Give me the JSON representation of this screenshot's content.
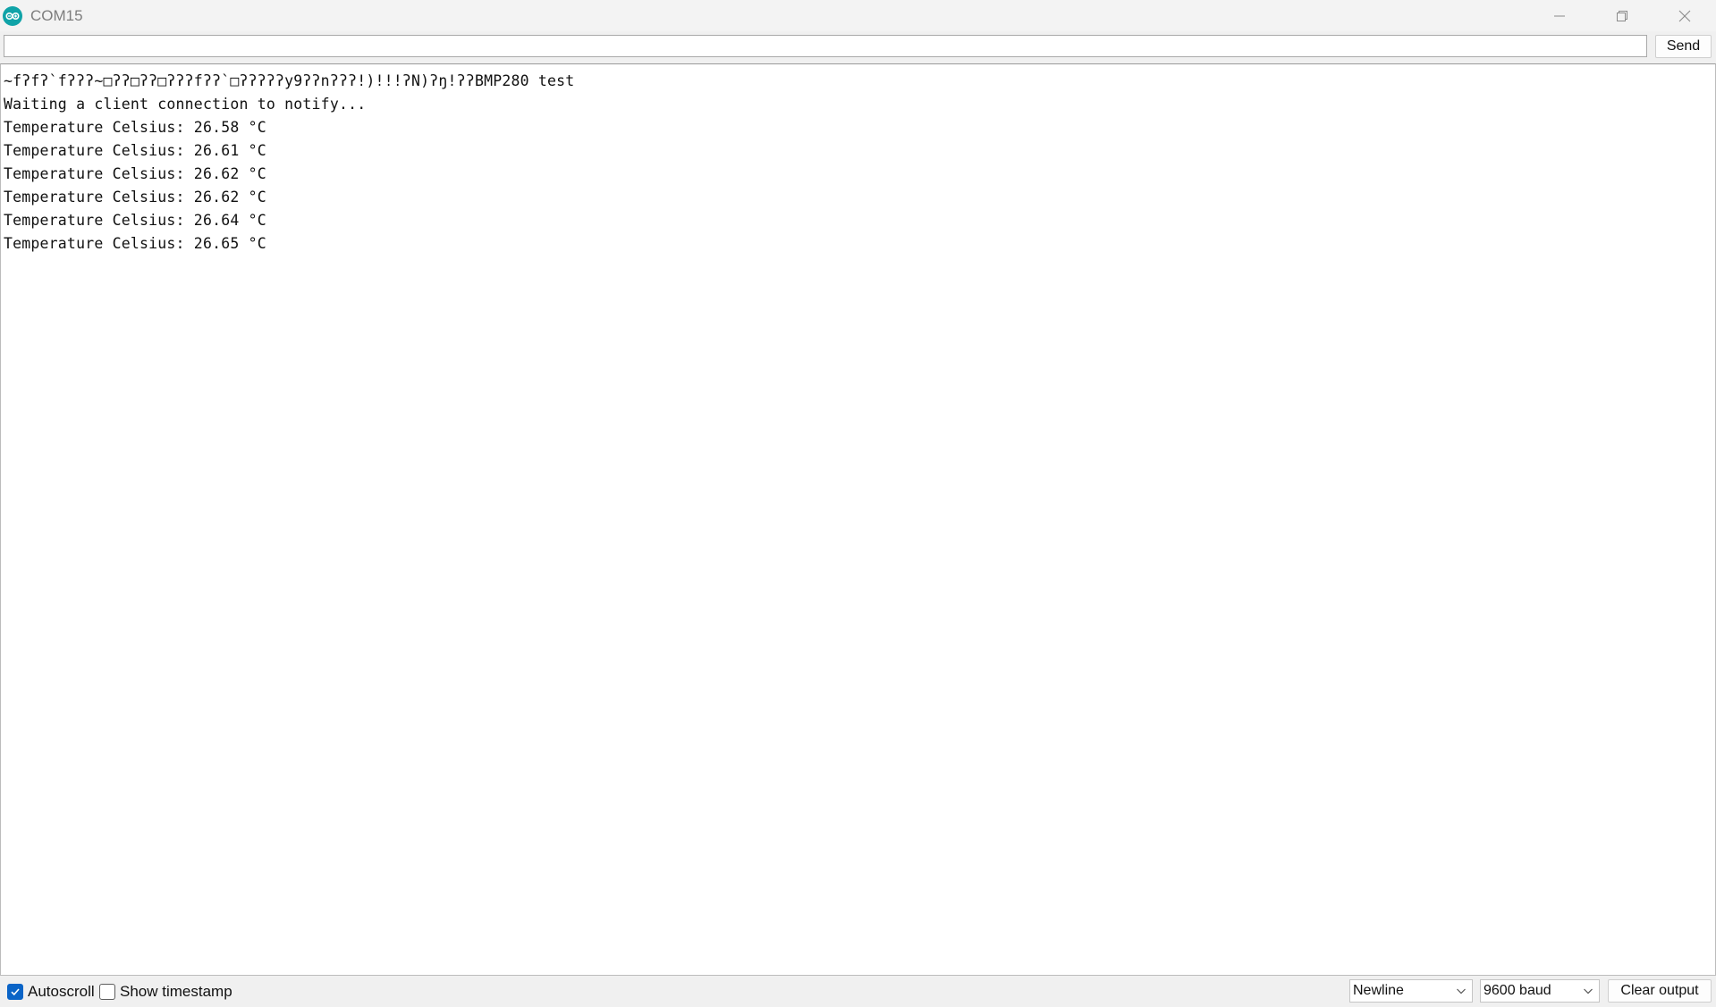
{
  "window": {
    "title": "COM15",
    "controls": [
      "minimize",
      "restore",
      "close"
    ]
  },
  "send_bar": {
    "input_value": "",
    "send_label": "Send"
  },
  "output": {
    "lines": [
      "~fʔfʔ`fʔʔʔ~□ʔʔ□ʔʔ□ʔʔʔfʔʔ`□ʔʔʔʔʔy9ʔʔnʔʔʔ!)!!!ʔN)ʔŋ!ʔʔBMP280 test",
      "Waiting a client connection to notify...",
      "Temperature Celsius: 26.58 °C",
      "Temperature Celsius: 26.61 °C",
      "Temperature Celsius: 26.62 °C",
      "Temperature Celsius: 26.62 °C",
      "Temperature Celsius: 26.64 °C",
      "Temperature Celsius: 26.65 °C"
    ]
  },
  "bottom_bar": {
    "autoscroll_label": "Autoscroll",
    "autoscroll_checked": true,
    "timestamp_label": "Show timestamp",
    "timestamp_checked": false,
    "line_ending_value": "Newline",
    "baud_value": "9600 baud",
    "clear_label": "Clear output"
  },
  "colors": {
    "accent": "#0a64c7",
    "app_icon": "#10a3a8"
  },
  "icons": {
    "app": "arduino-logo-icon",
    "minimize": "minimize-icon",
    "restore": "restore-icon",
    "close": "close-icon",
    "dropdown": "chevron-down-icon",
    "check": "check-icon"
  }
}
